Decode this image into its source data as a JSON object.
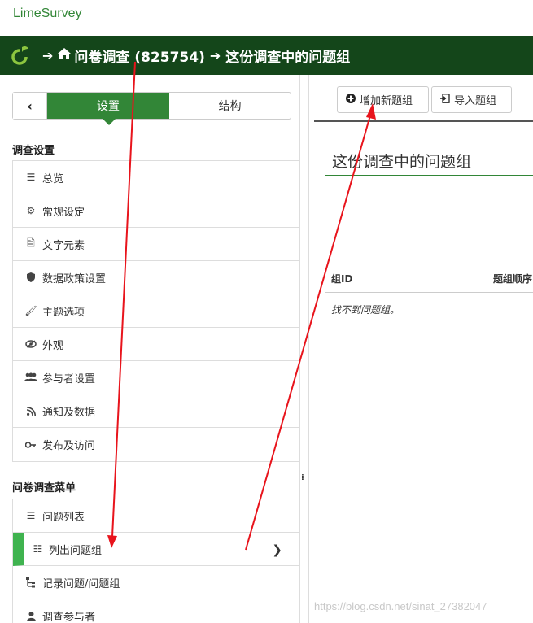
{
  "brand": "LimeSurvey",
  "breadcrumb": {
    "survey": "问卷调查 (825754)",
    "current": "这份调查中的问题组"
  },
  "sidebar": {
    "tabs": {
      "settings": "设置",
      "structure": "结构"
    },
    "section1_title": "调查设置",
    "section1_items": [
      {
        "label": "总览",
        "icon": "list-icon"
      },
      {
        "label": "常规设定",
        "icon": "cogs-icon"
      },
      {
        "label": "文字元素",
        "icon": "file-text-icon"
      },
      {
        "label": "数据政策设置",
        "icon": "shield-icon"
      },
      {
        "label": "主题选项",
        "icon": "brush-icon"
      },
      {
        "label": "外观",
        "icon": "eye-slash-icon"
      },
      {
        "label": "参与者设置",
        "icon": "users-icon"
      },
      {
        "label": "通知及数据",
        "icon": "rss-icon"
      },
      {
        "label": "发布及访问",
        "icon": "key-icon"
      }
    ],
    "section2_title": "问卷调查菜单",
    "section2_items": [
      {
        "label": "问题列表",
        "icon": "list-icon"
      },
      {
        "label": "列出问题组",
        "icon": "th-list-icon"
      },
      {
        "label": "记录问题/问题组",
        "icon": "sitemap-icon"
      },
      {
        "label": "调查参与者",
        "icon": "user-icon"
      }
    ]
  },
  "toolbar": {
    "add_group": "增加新题组",
    "import_group": "导入题组"
  },
  "content": {
    "title": "这份调查中的问题组",
    "columns": [
      "组ID",
      "题组顺序"
    ],
    "empty_text": "找不到问题组。"
  },
  "watermark": "https://blog.csdn.net/sinat_27382047",
  "colors": {
    "brand": "#328637",
    "header_bg": "#14461a",
    "active": "#3fb34f",
    "arrow": "#e8141c"
  }
}
